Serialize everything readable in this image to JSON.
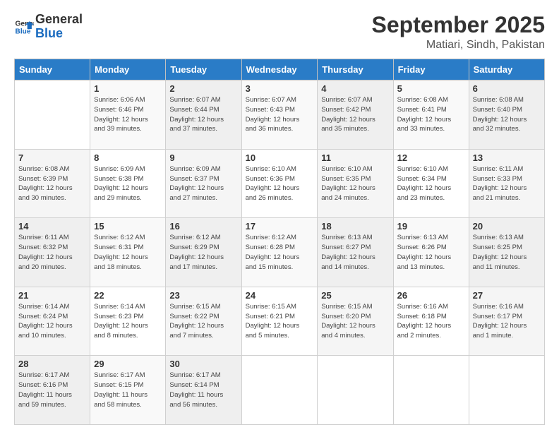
{
  "logo": {
    "text_general": "General",
    "text_blue": "Blue"
  },
  "header": {
    "title": "September 2025",
    "subtitle": "Matiari, Sindh, Pakistan"
  },
  "weekdays": [
    "Sunday",
    "Monday",
    "Tuesday",
    "Wednesday",
    "Thursday",
    "Friday",
    "Saturday"
  ],
  "weeks": [
    [
      {
        "day": "",
        "info": ""
      },
      {
        "day": "1",
        "info": "Sunrise: 6:06 AM\nSunset: 6:46 PM\nDaylight: 12 hours\nand 39 minutes."
      },
      {
        "day": "2",
        "info": "Sunrise: 6:07 AM\nSunset: 6:44 PM\nDaylight: 12 hours\nand 37 minutes."
      },
      {
        "day": "3",
        "info": "Sunrise: 6:07 AM\nSunset: 6:43 PM\nDaylight: 12 hours\nand 36 minutes."
      },
      {
        "day": "4",
        "info": "Sunrise: 6:07 AM\nSunset: 6:42 PM\nDaylight: 12 hours\nand 35 minutes."
      },
      {
        "day": "5",
        "info": "Sunrise: 6:08 AM\nSunset: 6:41 PM\nDaylight: 12 hours\nand 33 minutes."
      },
      {
        "day": "6",
        "info": "Sunrise: 6:08 AM\nSunset: 6:40 PM\nDaylight: 12 hours\nand 32 minutes."
      }
    ],
    [
      {
        "day": "7",
        "info": "Sunrise: 6:08 AM\nSunset: 6:39 PM\nDaylight: 12 hours\nand 30 minutes."
      },
      {
        "day": "8",
        "info": "Sunrise: 6:09 AM\nSunset: 6:38 PM\nDaylight: 12 hours\nand 29 minutes."
      },
      {
        "day": "9",
        "info": "Sunrise: 6:09 AM\nSunset: 6:37 PM\nDaylight: 12 hours\nand 27 minutes."
      },
      {
        "day": "10",
        "info": "Sunrise: 6:10 AM\nSunset: 6:36 PM\nDaylight: 12 hours\nand 26 minutes."
      },
      {
        "day": "11",
        "info": "Sunrise: 6:10 AM\nSunset: 6:35 PM\nDaylight: 12 hours\nand 24 minutes."
      },
      {
        "day": "12",
        "info": "Sunrise: 6:10 AM\nSunset: 6:34 PM\nDaylight: 12 hours\nand 23 minutes."
      },
      {
        "day": "13",
        "info": "Sunrise: 6:11 AM\nSunset: 6:33 PM\nDaylight: 12 hours\nand 21 minutes."
      }
    ],
    [
      {
        "day": "14",
        "info": "Sunrise: 6:11 AM\nSunset: 6:32 PM\nDaylight: 12 hours\nand 20 minutes."
      },
      {
        "day": "15",
        "info": "Sunrise: 6:12 AM\nSunset: 6:31 PM\nDaylight: 12 hours\nand 18 minutes."
      },
      {
        "day": "16",
        "info": "Sunrise: 6:12 AM\nSunset: 6:29 PM\nDaylight: 12 hours\nand 17 minutes."
      },
      {
        "day": "17",
        "info": "Sunrise: 6:12 AM\nSunset: 6:28 PM\nDaylight: 12 hours\nand 15 minutes."
      },
      {
        "day": "18",
        "info": "Sunrise: 6:13 AM\nSunset: 6:27 PM\nDaylight: 12 hours\nand 14 minutes."
      },
      {
        "day": "19",
        "info": "Sunrise: 6:13 AM\nSunset: 6:26 PM\nDaylight: 12 hours\nand 13 minutes."
      },
      {
        "day": "20",
        "info": "Sunrise: 6:13 AM\nSunset: 6:25 PM\nDaylight: 12 hours\nand 11 minutes."
      }
    ],
    [
      {
        "day": "21",
        "info": "Sunrise: 6:14 AM\nSunset: 6:24 PM\nDaylight: 12 hours\nand 10 minutes."
      },
      {
        "day": "22",
        "info": "Sunrise: 6:14 AM\nSunset: 6:23 PM\nDaylight: 12 hours\nand 8 minutes."
      },
      {
        "day": "23",
        "info": "Sunrise: 6:15 AM\nSunset: 6:22 PM\nDaylight: 12 hours\nand 7 minutes."
      },
      {
        "day": "24",
        "info": "Sunrise: 6:15 AM\nSunset: 6:21 PM\nDaylight: 12 hours\nand 5 minutes."
      },
      {
        "day": "25",
        "info": "Sunrise: 6:15 AM\nSunset: 6:20 PM\nDaylight: 12 hours\nand 4 minutes."
      },
      {
        "day": "26",
        "info": "Sunrise: 6:16 AM\nSunset: 6:18 PM\nDaylight: 12 hours\nand 2 minutes."
      },
      {
        "day": "27",
        "info": "Sunrise: 6:16 AM\nSunset: 6:17 PM\nDaylight: 12 hours\nand 1 minute."
      }
    ],
    [
      {
        "day": "28",
        "info": "Sunrise: 6:17 AM\nSunset: 6:16 PM\nDaylight: 11 hours\nand 59 minutes."
      },
      {
        "day": "29",
        "info": "Sunrise: 6:17 AM\nSunset: 6:15 PM\nDaylight: 11 hours\nand 58 minutes."
      },
      {
        "day": "30",
        "info": "Sunrise: 6:17 AM\nSunset: 6:14 PM\nDaylight: 11 hours\nand 56 minutes."
      },
      {
        "day": "",
        "info": ""
      },
      {
        "day": "",
        "info": ""
      },
      {
        "day": "",
        "info": ""
      },
      {
        "day": "",
        "info": ""
      }
    ]
  ]
}
